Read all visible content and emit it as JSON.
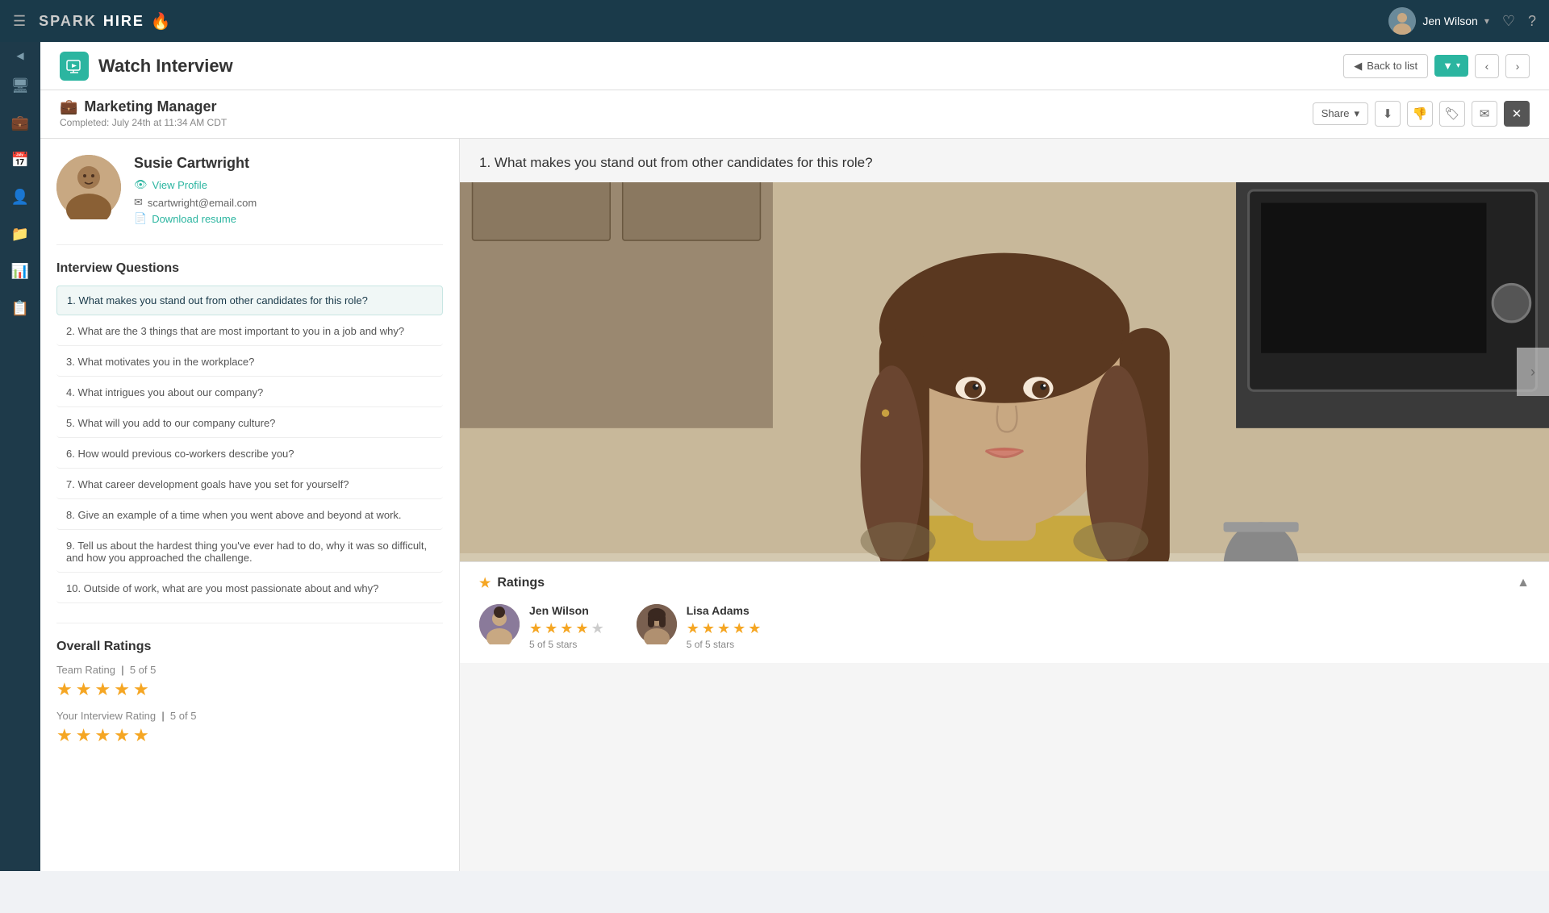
{
  "app": {
    "name_spark": "SPARK",
    "name_hire": "HIRE",
    "flame": "🔥"
  },
  "topnav": {
    "user_name": "Jen Wilson",
    "chevron": "▾"
  },
  "page": {
    "title": "Watch Interview",
    "back_to_list": "Back to list",
    "filter_icon": "▼",
    "share_label": "Share",
    "chevron": "▾"
  },
  "job": {
    "icon": "💼",
    "title": "Marketing Manager",
    "completed": "Completed: July 24th at 11:34 AM CDT"
  },
  "candidate": {
    "name": "Susie Cartwright",
    "view_profile": "View Profile",
    "email": "scartwright@email.com",
    "resume": "Download resume"
  },
  "questions_section_title": "Interview Questions",
  "questions": [
    "1. What makes you stand out from other candidates for this role?",
    "2. What are the 3 things that are most important to you in a job and why?",
    "3. What motivates you in the workplace?",
    "4. What intrigues you about our company?",
    "5. What will you add to our company culture?",
    "6. How would previous co-workers describe you?",
    "7. What career development goals have you set for yourself?",
    "8. Give an example of a time when you went above and beyond at work.",
    "9. Tell us about the hardest thing you've ever had to do, why it was so difficult, and how you approached the challenge.",
    "10. Outside of work, what are you most passionate about and why?"
  ],
  "ratings": {
    "section_title": "Overall Ratings",
    "team_label": "Team Rating",
    "team_score": "5 of 5",
    "your_label": "Your Interview Rating",
    "your_score": "5 of 5"
  },
  "video": {
    "question": "1. What makes you stand out from other candidates for this role?"
  },
  "raters_section": {
    "title": "Ratings",
    "raters": [
      {
        "name": "Jen Wilson",
        "stars": 4.5,
        "stars_text": "5 of 5 stars"
      },
      {
        "name": "Lisa Adams",
        "stars": 5,
        "stars_text": "5 of 5 stars"
      }
    ]
  },
  "sidebar": {
    "items": [
      {
        "icon": "🖥",
        "name": "dashboard"
      },
      {
        "icon": "💼",
        "name": "jobs"
      },
      {
        "icon": "📅",
        "name": "calendar"
      },
      {
        "icon": "👤",
        "name": "candidates"
      },
      {
        "icon": "📁",
        "name": "files"
      },
      {
        "icon": "📊",
        "name": "reports"
      },
      {
        "icon": "📋",
        "name": "reviews"
      }
    ]
  }
}
